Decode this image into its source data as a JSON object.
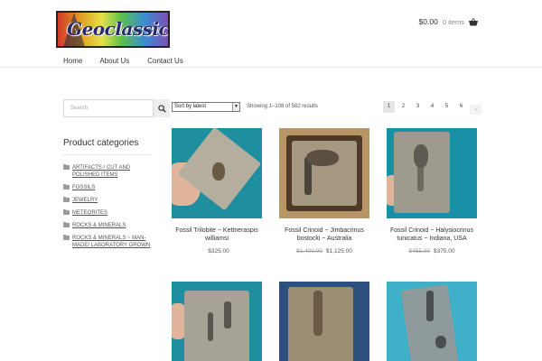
{
  "header": {
    "logo_text": "Geoclassics",
    "cart_amount": "$0.00",
    "cart_items": "0 items"
  },
  "nav": {
    "items": [
      "Home",
      "About Us",
      "Contact Us"
    ]
  },
  "sidebar": {
    "search_placeholder": "Search",
    "categories_title": "Product categories",
    "categories": [
      "ARTIFACTS / CUT AND POLISHED ITEMS",
      "FOSSILS",
      "JEWELRY",
      "METEORITES",
      "ROCKS & MINERALS",
      "ROCKS & MINERALS ~ MAN-MADE/ LABORATORY GROWN"
    ]
  },
  "toolbar": {
    "sort_selected": "Sort by latest",
    "result_count": "Showing 1–108 of 582 results",
    "pages": [
      "1",
      "2",
      "3",
      "4",
      "5",
      "6"
    ],
    "next": "→"
  },
  "products": [
    {
      "name": "Fossil Trilobite ~ Kettneraspis williamsi",
      "regular_price": "",
      "price": "$325.00"
    },
    {
      "name": "Fossil Crinoid ~ Jimbacrinus bostocki ~ Australia",
      "regular_price": "$1,400.00",
      "price": "$1,125.00"
    },
    {
      "name": "Fossil Crinoid ~ Halysiocrinus tunicatus ~ Indiana, USA",
      "regular_price": "$455.00",
      "price": "$375.00"
    },
    {
      "name": "",
      "regular_price": "",
      "price": ""
    },
    {
      "name": "",
      "regular_price": "",
      "price": ""
    },
    {
      "name": "",
      "regular_price": "",
      "price": ""
    }
  ]
}
